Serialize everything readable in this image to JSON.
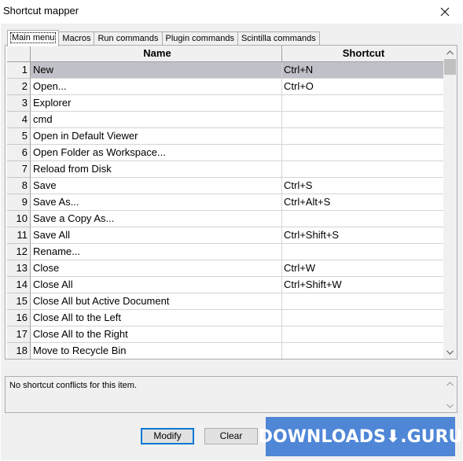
{
  "window": {
    "title": "Shortcut mapper"
  },
  "tabs": [
    {
      "label": "Main menu",
      "active": true
    },
    {
      "label": "Macros",
      "active": false
    },
    {
      "label": "Run commands",
      "active": false
    },
    {
      "label": "Plugin commands",
      "active": false
    },
    {
      "label": "Scintilla commands",
      "active": false
    }
  ],
  "grid": {
    "columns": {
      "name": "Name",
      "shortcut": "Shortcut"
    },
    "selected_row": 1,
    "rows": [
      {
        "num": "1",
        "name": "New",
        "shortcut": "Ctrl+N"
      },
      {
        "num": "2",
        "name": "Open...",
        "shortcut": "Ctrl+O"
      },
      {
        "num": "3",
        "name": "Explorer",
        "shortcut": ""
      },
      {
        "num": "4",
        "name": "cmd",
        "shortcut": ""
      },
      {
        "num": "5",
        "name": "Open in Default Viewer",
        "shortcut": ""
      },
      {
        "num": "6",
        "name": "Open Folder as Workspace...",
        "shortcut": ""
      },
      {
        "num": "7",
        "name": "Reload from Disk",
        "shortcut": ""
      },
      {
        "num": "8",
        "name": "Save",
        "shortcut": "Ctrl+S"
      },
      {
        "num": "9",
        "name": "Save As...",
        "shortcut": "Ctrl+Alt+S"
      },
      {
        "num": "10",
        "name": "Save a Copy As...",
        "shortcut": ""
      },
      {
        "num": "11",
        "name": "Save All",
        "shortcut": "Ctrl+Shift+S"
      },
      {
        "num": "12",
        "name": "Rename...",
        "shortcut": ""
      },
      {
        "num": "13",
        "name": "Close",
        "shortcut": "Ctrl+W"
      },
      {
        "num": "14",
        "name": "Close All",
        "shortcut": "Ctrl+Shift+W"
      },
      {
        "num": "15",
        "name": "Close All but Active Document",
        "shortcut": ""
      },
      {
        "num": "16",
        "name": "Close All to the Left",
        "shortcut": ""
      },
      {
        "num": "17",
        "name": "Close All to the Right",
        "shortcut": ""
      },
      {
        "num": "18",
        "name": "Move to Recycle Bin",
        "shortcut": ""
      }
    ]
  },
  "conflicts": {
    "text": "No shortcut conflicts for this item."
  },
  "buttons": {
    "modify": "Modify",
    "clear": "Clear"
  },
  "watermark": {
    "text": "DOWNLOADS⬇.GURU"
  },
  "colors": {
    "selected_row": "#c0c0c8",
    "dialog_bg": "#f0f0f0",
    "watermark_bg": "#4f86d6"
  }
}
